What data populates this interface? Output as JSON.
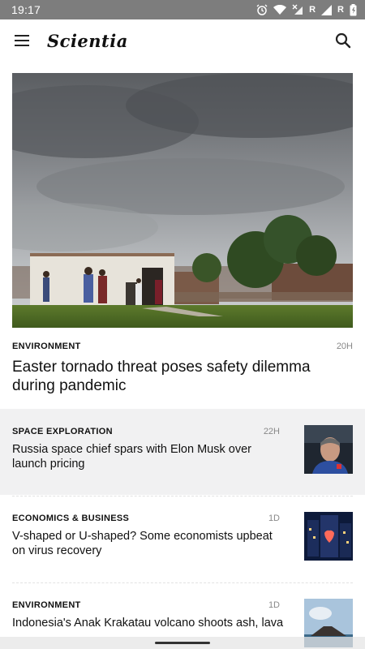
{
  "status_bar": {
    "time": "19:17",
    "icons": [
      "alarm-icon",
      "wifi-icon",
      "signal-x-icon",
      "r-label",
      "signal-icon",
      "r-label",
      "battery-icon"
    ],
    "roaming_label": "R"
  },
  "app_bar": {
    "menu_icon": "hamburger-menu-icon",
    "title": "Scientia",
    "search_icon": "search-icon"
  },
  "hero": {
    "category": "ENVIRONMENT",
    "age": "20H",
    "title": "Easter tornado threat poses safety dilemma during pandemic"
  },
  "stories": [
    {
      "category": "SPACE EXPLORATION",
      "age": "22H",
      "title": "Russia space chief spars with Elon Musk over launch pricing",
      "highlighted": true
    },
    {
      "category": "ECONOMICS & BUSINESS",
      "age": "1D",
      "title": "V-shaped or U-shaped? Some economists upbeat on virus recovery",
      "highlighted": false
    },
    {
      "category": "ENVIRONMENT",
      "age": "1D",
      "title": "Indonesia's Anak Krakatau volcano shoots ash, lava",
      "highlighted": false
    }
  ],
  "colors": {
    "status_bar_bg": "#7d7d7d",
    "highlight_bg": "#f1f1f2",
    "muted_text": "#888888"
  }
}
